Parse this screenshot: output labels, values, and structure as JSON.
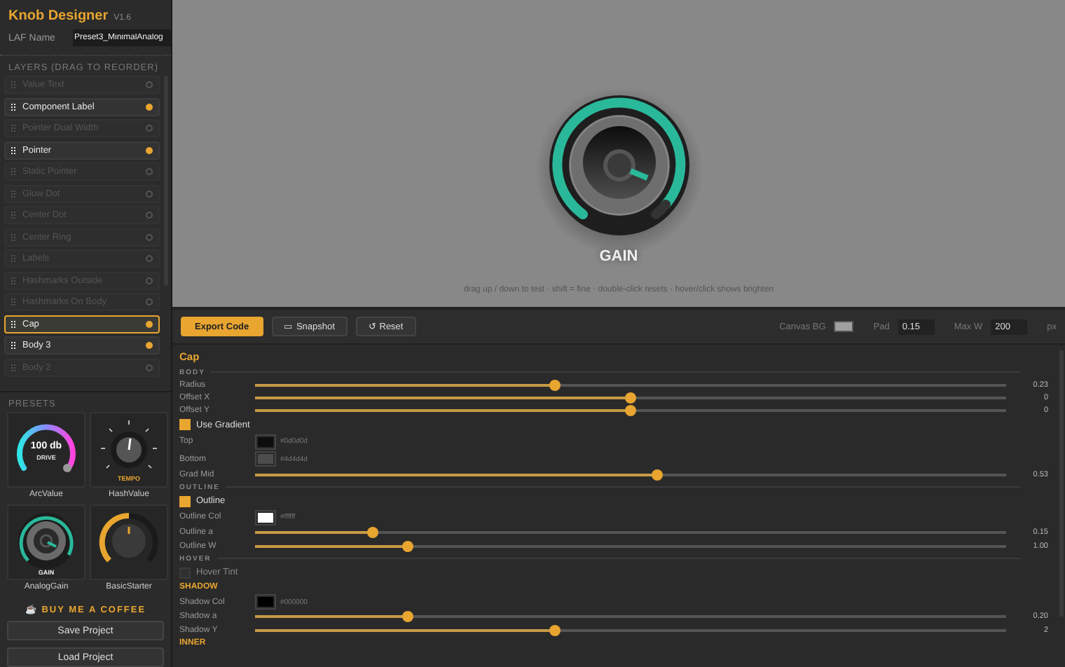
{
  "app": {
    "title": "Knob Designer",
    "version": "V1.6"
  },
  "laf": {
    "label": "LAF Name",
    "value": "Preset3_MinimalAnalog"
  },
  "layers": {
    "title": "LAYERS (DRAG TO REORDER)",
    "items": [
      {
        "label": "Value Text",
        "enabled": false,
        "selected": false
      },
      {
        "label": "Component Label",
        "enabled": true,
        "selected": false
      },
      {
        "label": "Pointer Dual Width",
        "enabled": false,
        "selected": false
      },
      {
        "label": "Pointer",
        "enabled": true,
        "selected": false
      },
      {
        "label": "Static Pointer",
        "enabled": false,
        "selected": false
      },
      {
        "label": "Glow Dot",
        "enabled": false,
        "selected": false
      },
      {
        "label": "Center Dot",
        "enabled": false,
        "selected": false
      },
      {
        "label": "Center Ring",
        "enabled": false,
        "selected": false
      },
      {
        "label": "Labels",
        "enabled": false,
        "selected": false
      },
      {
        "label": "Hashmarks Outside",
        "enabled": false,
        "selected": false
      },
      {
        "label": "Hashmarks On Body",
        "enabled": false,
        "selected": false
      },
      {
        "label": "Cap",
        "enabled": true,
        "selected": true
      },
      {
        "label": "Body 3",
        "enabled": true,
        "selected": false
      },
      {
        "label": "Body 2",
        "enabled": false,
        "selected": false
      }
    ]
  },
  "presets": {
    "title": "PRESETS",
    "items": [
      {
        "kind": "arc",
        "label": "ArcValue",
        "display_value": "100 db",
        "display_label": "DRIVE"
      },
      {
        "kind": "hash",
        "label": "HashValue",
        "display_label": "TEMPO"
      },
      {
        "kind": "analog",
        "label": "AnalogGain",
        "display_label": "GAIN"
      },
      {
        "kind": "basic",
        "label": "BasicStarter"
      }
    ]
  },
  "coffee": {
    "icon": "☕",
    "label": "BUY ME A COFFEE"
  },
  "project_buttons": [
    "Save Project",
    "Load Project"
  ],
  "canvas": {
    "knob_label": "GAIN",
    "hint": "drag up / down to test · shift = fine · double-click resets · hover/click shows brighten"
  },
  "toolbar": {
    "buttons": [
      {
        "label": "Export Code",
        "primary": true
      },
      {
        "label": "Snapshot",
        "primary": false,
        "icon": "▭"
      },
      {
        "label": "Reset",
        "primary": false,
        "icon": "↺"
      }
    ],
    "canvas_bg": {
      "label": "Canvas BG",
      "color": "#a0a0a0"
    },
    "pad": {
      "label": "Pad",
      "value": "0.15"
    },
    "max_w": {
      "label": "Max W",
      "value": "200",
      "unit": "px"
    }
  },
  "properties": {
    "title": "Cap",
    "rows": [
      {
        "kind": "section",
        "label": "BODY",
        "accent": false
      },
      {
        "kind": "slider",
        "label": "Radius",
        "level": 0.4,
        "reading": "0.23"
      },
      {
        "kind": "slider",
        "label": "Offset X",
        "level": 0.5,
        "reading": "0"
      },
      {
        "kind": "slider",
        "label": "Offset Y",
        "level": 0.5,
        "reading": "0"
      },
      {
        "kind": "checkbox",
        "label": "Use Gradient",
        "checked": true
      },
      {
        "kind": "color",
        "label": "Top",
        "color": "#0d0d0d",
        "hex": "#0d0d0d"
      },
      {
        "kind": "color",
        "label": "Bottom",
        "color": "#4d4d4d",
        "hex": "#4d4d4d"
      },
      {
        "kind": "slider",
        "label": "Grad Mid",
        "level": 0.536,
        "reading": "0.53"
      },
      {
        "kind": "section",
        "label": "OUTLINE",
        "accent": false
      },
      {
        "kind": "checkbox",
        "label": "Outline",
        "checked": true
      },
      {
        "kind": "color",
        "label": "Outline Col",
        "color": "#ffffff",
        "hex": "#ffffff"
      },
      {
        "kind": "slider",
        "label": "Outline a",
        "level": 0.156,
        "reading": "0.15"
      },
      {
        "kind": "slider",
        "label": "Outline W",
        "level": 0.204,
        "reading": "1.00"
      },
      {
        "kind": "section",
        "label": "HOVER",
        "accent": false
      },
      {
        "kind": "checkbox",
        "label": "Hover Tint",
        "checked": false
      },
      {
        "kind": "section",
        "label": "SHADOW",
        "accent": true
      },
      {
        "kind": "color",
        "label": "Shadow Col",
        "color": "#000000",
        "hex": "#000000"
      },
      {
        "kind": "slider",
        "label": "Shadow a",
        "level": 0.204,
        "reading": "0.20"
      },
      {
        "kind": "slider",
        "label": "Shadow Y",
        "level": 0.4,
        "reading": "2"
      },
      {
        "kind": "section",
        "label": "INNER",
        "accent": true
      }
    ]
  }
}
